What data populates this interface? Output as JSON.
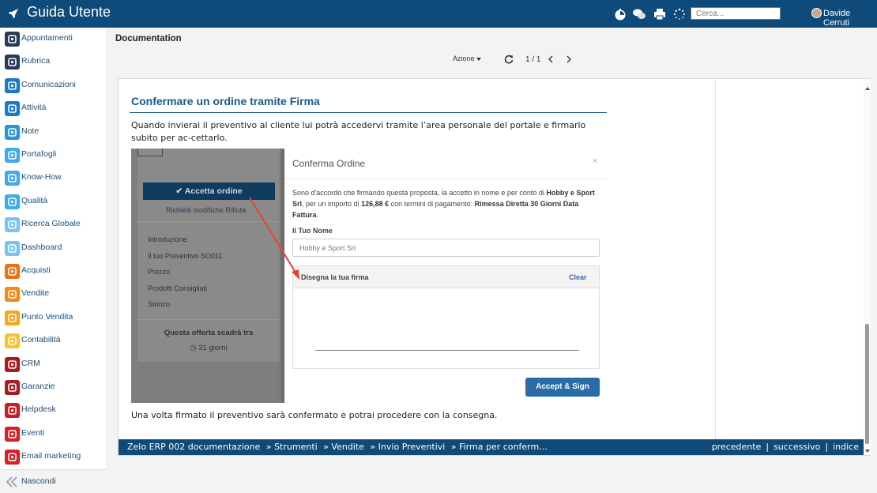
{
  "header": {
    "title": "Guida Utente",
    "search_placeholder": "Cerca...",
    "user_name": "Davide Cerruti"
  },
  "sidebar": {
    "items": [
      {
        "label": "Appuntamenti",
        "color": "#2b3a55"
      },
      {
        "label": "Rubrica",
        "color": "#2b3a55"
      },
      {
        "label": "Comunicazioni",
        "color": "#1f78c1"
      },
      {
        "label": "Attività",
        "color": "#1f78c1"
      },
      {
        "label": "Note",
        "color": "#2f93d8"
      },
      {
        "label": "Portafogli",
        "color": "#45a9e6"
      },
      {
        "label": "Know-How",
        "color": "#45a9e6"
      },
      {
        "label": "Qualità",
        "color": "#45a9e6"
      },
      {
        "label": "Ricerca Globale",
        "color": "#7cc3ee"
      },
      {
        "label": "Dashboard",
        "color": "#7cc3ee"
      },
      {
        "label": "Acquisti",
        "color": "#e8731d"
      },
      {
        "label": "Vendite",
        "color": "#f08a1c"
      },
      {
        "label": "Punto Vendita",
        "color": "#f5a623"
      },
      {
        "label": "Contabilità",
        "color": "#f7c23a"
      },
      {
        "label": "CRM",
        "color": "#a31f24"
      },
      {
        "label": "Garanzie",
        "color": "#a31f24"
      },
      {
        "label": "Helpdesk",
        "color": "#c62027"
      },
      {
        "label": "Eventi",
        "color": "#d2232a"
      },
      {
        "label": "Email marketing",
        "color": "#d2232a"
      }
    ],
    "collapse_label": "Nascondi"
  },
  "main": {
    "page_title": "Documentation",
    "action_label": "Azione",
    "pager": "1 / 1"
  },
  "doc": {
    "heading": "Confermare un ordine tramite Firma",
    "paragraph1": "Quando invierai il preventivo al cliente lui potrà accedervi tramite l’area personale del portale e firmarlo subito per ac-cettarlo.",
    "paragraph2": "Una volta firmato il preventivo sarà confermato e potrai procedere con la consegna.",
    "screenshot": {
      "accept_button": "Accetta ordine",
      "request_links": "Richiedi modifiche  Rifiuta",
      "menu": [
        "Introduzione",
        "Il tuo Preventivo SO011",
        "Prezzo",
        "Prodotti Consigliati",
        "Storico"
      ],
      "expires_text": "Questa offerta scadrà tra",
      "days_text": "31 giorni",
      "modal_title": "Conferma Ordine",
      "modal_close": "×",
      "modal_text_1": "Sono d'accordo che firmando questa proposta, la accetto in nome e per conto di ",
      "modal_text_company": "Hobby e Sport Srl",
      "modal_text_2": ", per un importo di ",
      "modal_text_amount": "126,88 €",
      "modal_text_3": " con termini di pagamento: ",
      "modal_text_terms": "Rimessa Diretta 30 Giorni Data Fattura",
      "modal_text_4": ".",
      "name_label": "Il Tuo Nome",
      "name_value": "Hobby e Sport Srl",
      "sign_label": "Disegna la tua firma",
      "clear_label": "Clear",
      "accept_sign_label": "Accept & Sign"
    }
  },
  "footer_nav": {
    "crumbs": [
      "Zelo ERP 002 documentazione",
      "» Strumenti",
      "» Vendite",
      "» Invio Preventivi",
      "» Firma per conferm..."
    ],
    "links": [
      "precedente",
      "successivo",
      "indice"
    ]
  },
  "colors": {
    "primary": "#0e4a7a",
    "heading": "#1a5a8a",
    "accept": "#2a6ca8"
  }
}
